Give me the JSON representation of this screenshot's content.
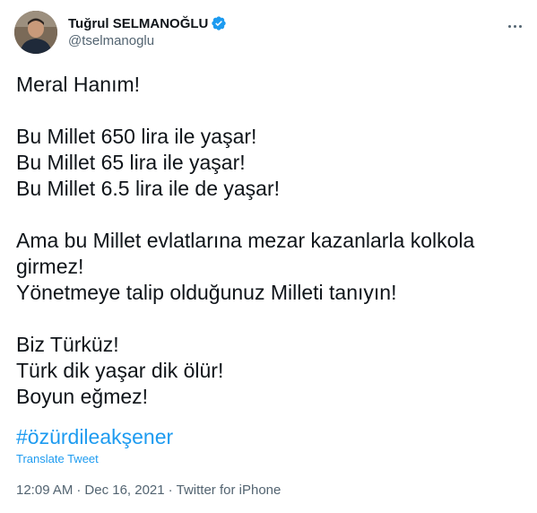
{
  "author": {
    "display_name": "Tuğrul SELMANOĞLU",
    "handle": "@tselmanoglu",
    "verified": true
  },
  "icons": {
    "verified": "verified-badge-icon",
    "more": "more-options-icon"
  },
  "tweet": {
    "lines": [
      "Meral Hanım!",
      "",
      "Bu Millet 650 lira ile yaşar!",
      "Bu Millet 65 lira ile yaşar!",
      "Bu Millet 6.5 lira ile de yaşar!",
      "",
      "Ama bu Millet evlatlarına mezar kazanlarla kolkola",
      "girmez!",
      "Yönetmeye talip olduğunuz Milleti tanıyın!",
      "",
      "Biz Türküz!",
      "Türk dik yaşar dik ölür!",
      "Boyun eğmez!"
    ],
    "hashtag": "#özürdileakşener",
    "translate_label": "Translate Tweet"
  },
  "meta": {
    "time": "12:09 AM",
    "separator": "·",
    "date": "Dec 16, 2021",
    "source": "Twitter for iPhone"
  },
  "colors": {
    "link": "#1d9bf0",
    "text": "#0f1419",
    "secondary": "#536471"
  }
}
